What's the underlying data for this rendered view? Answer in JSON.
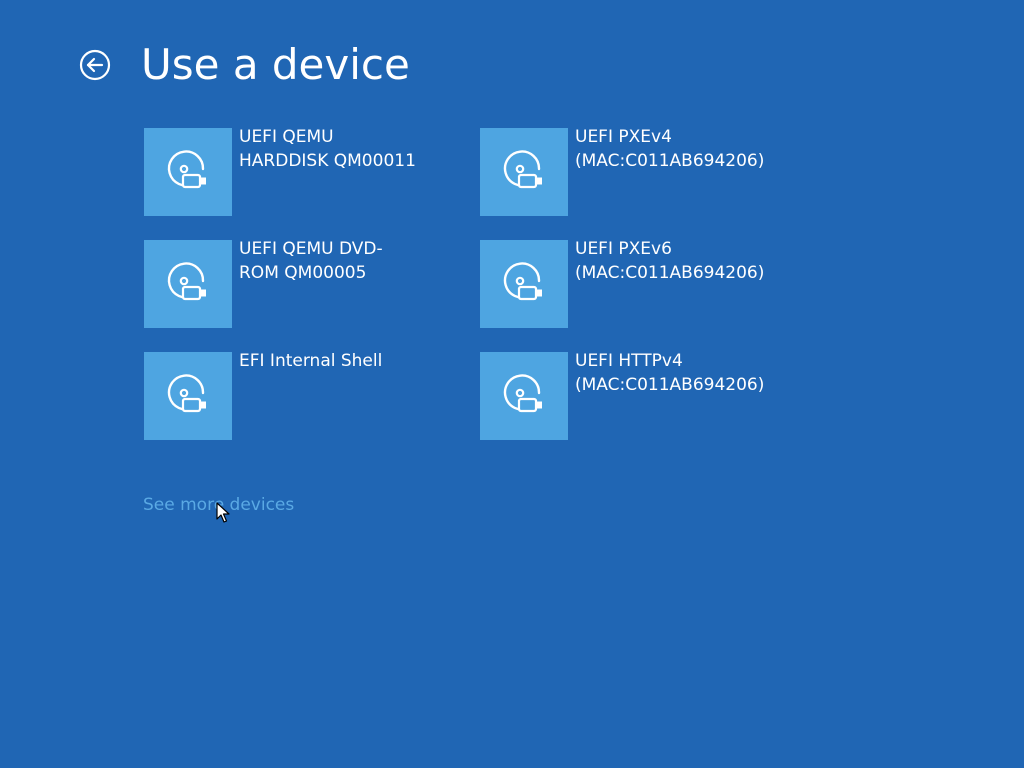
{
  "header": {
    "title": "Use a device",
    "back_icon": "back-arrow-circle-icon"
  },
  "devices": [
    {
      "label": "UEFI QEMU\nHARDDISK QM00011",
      "icon": "disk-drive-icon"
    },
    {
      "label": "UEFI PXEv4\n(MAC:C011AB694206)",
      "icon": "disk-drive-icon"
    },
    {
      "label": "UEFI QEMU DVD-\nROM QM00005",
      "icon": "disk-drive-icon"
    },
    {
      "label": "UEFI PXEv6\n(MAC:C011AB694206)",
      "icon": "disk-drive-icon"
    },
    {
      "label": "EFI Internal Shell",
      "icon": "disk-drive-icon"
    },
    {
      "label": "UEFI HTTPv4\n(MAC:C011AB694206)",
      "icon": "disk-drive-icon"
    }
  ],
  "footer": {
    "see_more_label": "See more devices"
  },
  "colors": {
    "background": "#2066b4",
    "tile": "#4ea5e1",
    "link": "#5aa9e4",
    "text": "#ffffff"
  }
}
